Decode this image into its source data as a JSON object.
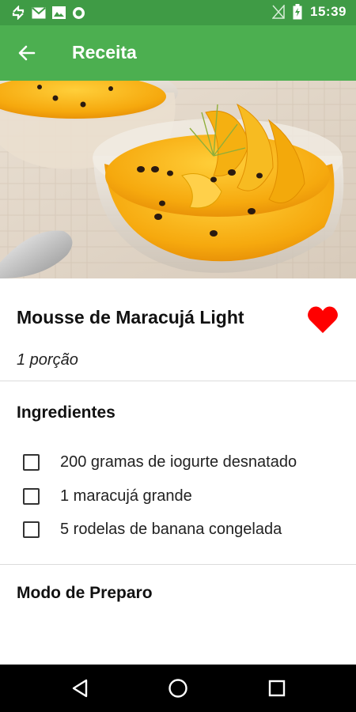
{
  "status_bar": {
    "time": "15:39",
    "icons": [
      "sync-icon",
      "gmail-icon",
      "image-icon",
      "circle-notification-icon",
      "no-signal-icon",
      "battery-charging-icon"
    ]
  },
  "app_bar": {
    "title": "Receita",
    "back_icon": "arrow-left-icon",
    "color": "#4caf50"
  },
  "recipe": {
    "title": "Mousse de Maracujá Light",
    "servings": "1 porção",
    "favorite": true,
    "favorite_color": "#ff0000"
  },
  "ingredients": {
    "heading": "Ingredientes",
    "items": [
      {
        "label": "200 gramas de iogurte desnatado",
        "checked": false
      },
      {
        "label": "1 maracujá grande",
        "checked": false
      },
      {
        "label": "5 rodelas de banana congelada",
        "checked": false
      }
    ]
  },
  "preparation": {
    "heading": "Modo de Preparo"
  },
  "nav_bar": {
    "buttons": [
      "back-triangle-icon",
      "home-circle-icon",
      "recents-square-icon"
    ]
  }
}
